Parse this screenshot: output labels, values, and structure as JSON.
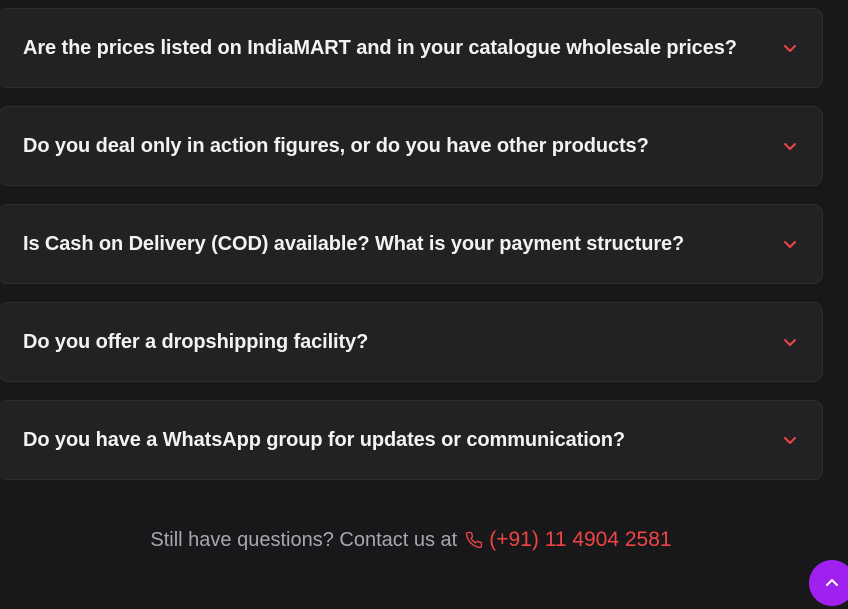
{
  "faq": {
    "items": [
      {
        "question": "Are the prices listed on IndiaMART and in your catalogue wholesale prices?"
      },
      {
        "question": "Do you deal only in action figures, or do you have other products?"
      },
      {
        "question": "Is Cash on Delivery (COD) available? What is your payment structure?"
      },
      {
        "question": "Do you offer a dropshipping facility?"
      },
      {
        "question": "Do you have a WhatsApp group for updates or communication?"
      }
    ],
    "chevron_icon": "chevron-down-icon"
  },
  "contact": {
    "prompt": "Still have questions? Contact us at",
    "phone": "(+91) 11 4904 2581",
    "phone_icon": "phone-icon"
  },
  "fab": {
    "icon": "chevron-up-icon"
  },
  "colors": {
    "background": "#18181a",
    "card": "#222224",
    "accent": "#ef4444",
    "fab": "#a020f0"
  }
}
